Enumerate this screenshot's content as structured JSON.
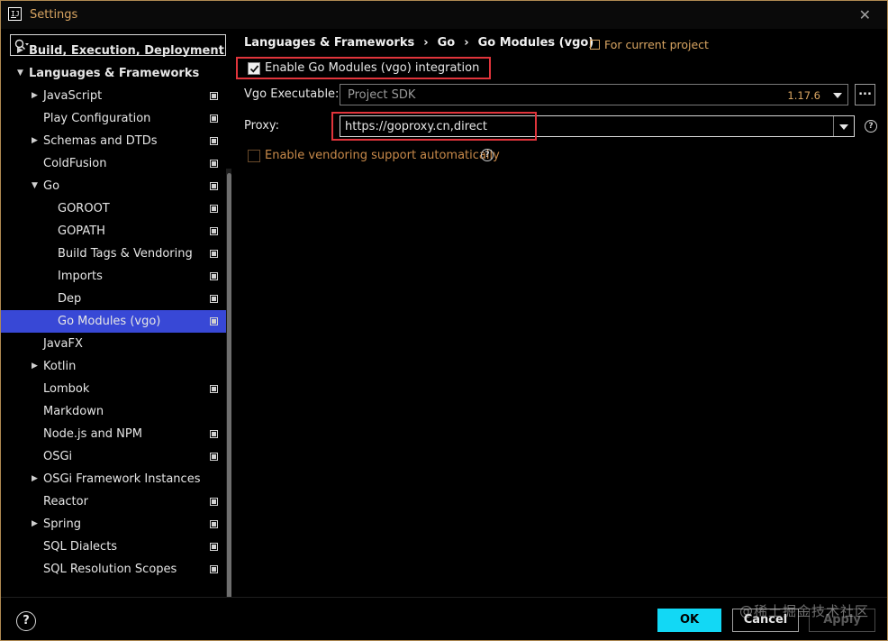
{
  "window": {
    "title": "Settings"
  },
  "search": {
    "placeholder": ""
  },
  "sidebar": {
    "items": [
      {
        "label": "Build, Execution, Deployment",
        "arrow": "▶",
        "bold": true
      },
      {
        "label": "Languages & Frameworks",
        "arrow": "▼",
        "bold": true
      },
      {
        "label": "JavaScript",
        "arrow": "▶",
        "proj": true
      },
      {
        "label": "Play Configuration",
        "proj": true
      },
      {
        "label": "Schemas and DTDs",
        "arrow": "▶",
        "proj": true
      },
      {
        "label": "ColdFusion",
        "proj": true
      },
      {
        "label": "Go",
        "arrow": "▼",
        "proj": true
      },
      {
        "label": "GOROOT",
        "proj": true
      },
      {
        "label": "GOPATH",
        "proj": true
      },
      {
        "label": "Build Tags & Vendoring",
        "proj": true
      },
      {
        "label": "Imports",
        "proj": true
      },
      {
        "label": "Dep",
        "proj": true
      },
      {
        "label": "Go Modules (vgo)",
        "proj": true,
        "selected": true
      },
      {
        "label": "JavaFX"
      },
      {
        "label": "Kotlin",
        "arrow": "▶"
      },
      {
        "label": "Lombok",
        "proj": true
      },
      {
        "label": "Markdown"
      },
      {
        "label": "Node.js and NPM",
        "proj": true
      },
      {
        "label": "OSGi",
        "proj": true
      },
      {
        "label": "OSGi Framework Instances",
        "arrow": "▶"
      },
      {
        "label": "Reactor",
        "proj": true
      },
      {
        "label": "Spring",
        "arrow": "▶",
        "proj": true
      },
      {
        "label": "SQL Dialects",
        "proj": true
      },
      {
        "label": "SQL Resolution Scopes",
        "proj": true
      }
    ]
  },
  "breadcrumb": {
    "part1": "Languages & Frameworks",
    "part2": "Go",
    "part3": "Go Modules (vgo)",
    "sep": "›"
  },
  "for_project": "For current project",
  "enable_vgo": {
    "label": "Enable Go Modules (vgo) integration",
    "checked": true
  },
  "vgo_executable": {
    "label": "Vgo Executable:",
    "value": "Project SDK",
    "version": "1.17.6",
    "browse": "..."
  },
  "proxy": {
    "label": "Proxy:",
    "value": "https://goproxy.cn,direct"
  },
  "vendoring": {
    "label": "Enable vendoring support automatically",
    "checked": false
  },
  "buttons": {
    "help": "?",
    "ok": "OK",
    "cancel": "Cancel",
    "apply": "Apply"
  },
  "close": "✕",
  "watermark": "@稀土掘金技术社区",
  "colors": {
    "accent_selected": "#3848d6",
    "ok_button": "#12d8f5",
    "highlight": "#e0343b",
    "link": "#d9a562"
  }
}
